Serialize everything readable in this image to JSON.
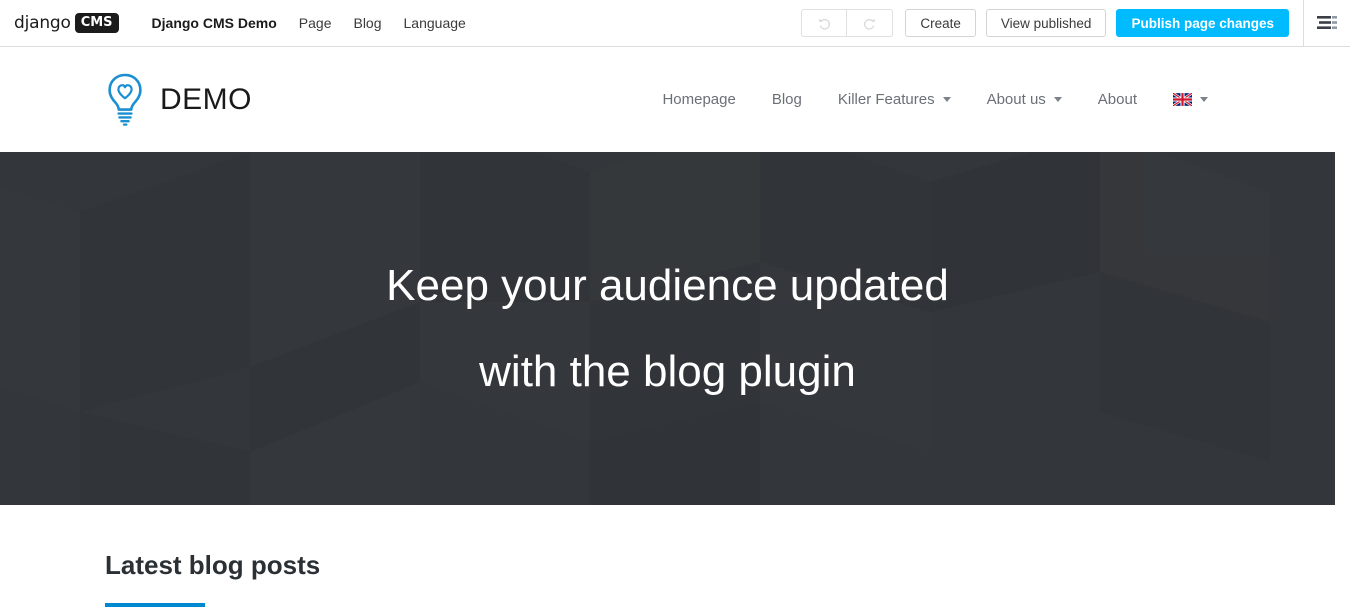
{
  "toolbar": {
    "logo_django": "django",
    "logo_badge": "CMS",
    "menus": [
      {
        "label": "Django CMS Demo",
        "bold": true
      },
      {
        "label": "Page",
        "bold": false
      },
      {
        "label": "Blog",
        "bold": false
      },
      {
        "label": "Language",
        "bold": false
      }
    ],
    "undo_icon": "undo-icon",
    "redo_icon": "redo-icon",
    "create_label": "Create",
    "view_published_label": "View published",
    "publish_label": "Publish page changes",
    "hamburger_icon": "hamburger-menu-icon",
    "accent_color": "#00bbff"
  },
  "site_header": {
    "logo_icon": "lightbulb-heart-icon",
    "brand_text": "DEMO",
    "nav": [
      {
        "label": "Homepage",
        "dropdown": false
      },
      {
        "label": "Blog",
        "dropdown": false
      },
      {
        "label": "Killer Features",
        "dropdown": true
      },
      {
        "label": "About us",
        "dropdown": true
      },
      {
        "label": "About",
        "dropdown": false
      }
    ],
    "language_icon": "uk-flag-icon",
    "language_dropdown": true
  },
  "hero": {
    "line1": "Keep your audience updated",
    "line2": "with the blog plugin",
    "background_color": "#33363a",
    "text_color": "#ffffff"
  },
  "content": {
    "section_title": "Latest blog posts",
    "rule_color": "#0089d0"
  }
}
